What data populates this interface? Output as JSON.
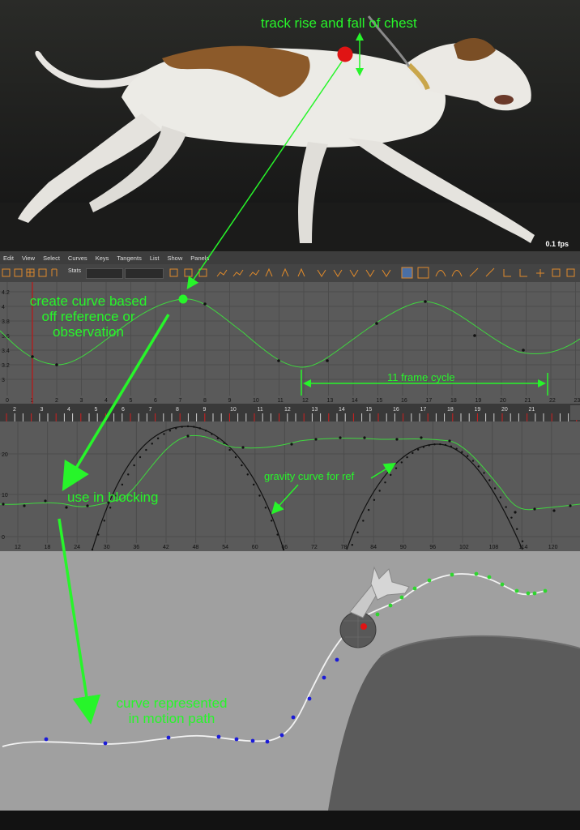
{
  "photo": {
    "fps_label": "0.1 fps"
  },
  "graph_editor": {
    "menu": [
      "Edit",
      "View",
      "Select",
      "Curves",
      "Keys",
      "Tangents",
      "List",
      "Show",
      "Panels"
    ],
    "stats_label": "Stats",
    "y_ticks": [
      "4.2",
      "4",
      "3.8",
      "3.6",
      "3.4",
      "3.2",
      "3"
    ],
    "x_ticks": [
      "0",
      "1",
      "2",
      "3",
      "4",
      "5",
      "6",
      "7",
      "8",
      "9",
      "10",
      "11",
      "12",
      "13",
      "14",
      "15",
      "16",
      "17",
      "18",
      "19",
      "20",
      "21",
      "22",
      "23"
    ],
    "curve_color": "#3fd83f",
    "key_color": "#111111"
  },
  "timeline": {
    "frames": [
      "2",
      "3",
      "4",
      "5",
      "6",
      "7",
      "8",
      "9",
      "10",
      "11",
      "12",
      "13",
      "14",
      "15",
      "16",
      "17",
      "18",
      "19",
      "20",
      "21"
    ]
  },
  "graph2": {
    "y_ticks": [
      "20",
      "10",
      "0"
    ],
    "x_ticks": [
      "12",
      "18",
      "24",
      "30",
      "36",
      "42",
      "48",
      "54",
      "60",
      "66",
      "72",
      "78",
      "84",
      "90",
      "96",
      "102",
      "108",
      "114",
      "120"
    ]
  },
  "annotations": {
    "chest": "track rise and fall of chest",
    "create_line1": "create curve based",
    "create_line2": "off reference or",
    "create_line3": "observation",
    "cycle": "11 frame cycle",
    "gravity": "gravity curve for ref",
    "blocking": "use in blocking",
    "motion_line1": "curve represented",
    "motion_line2": "in motion path",
    "color": "#27f52a"
  }
}
